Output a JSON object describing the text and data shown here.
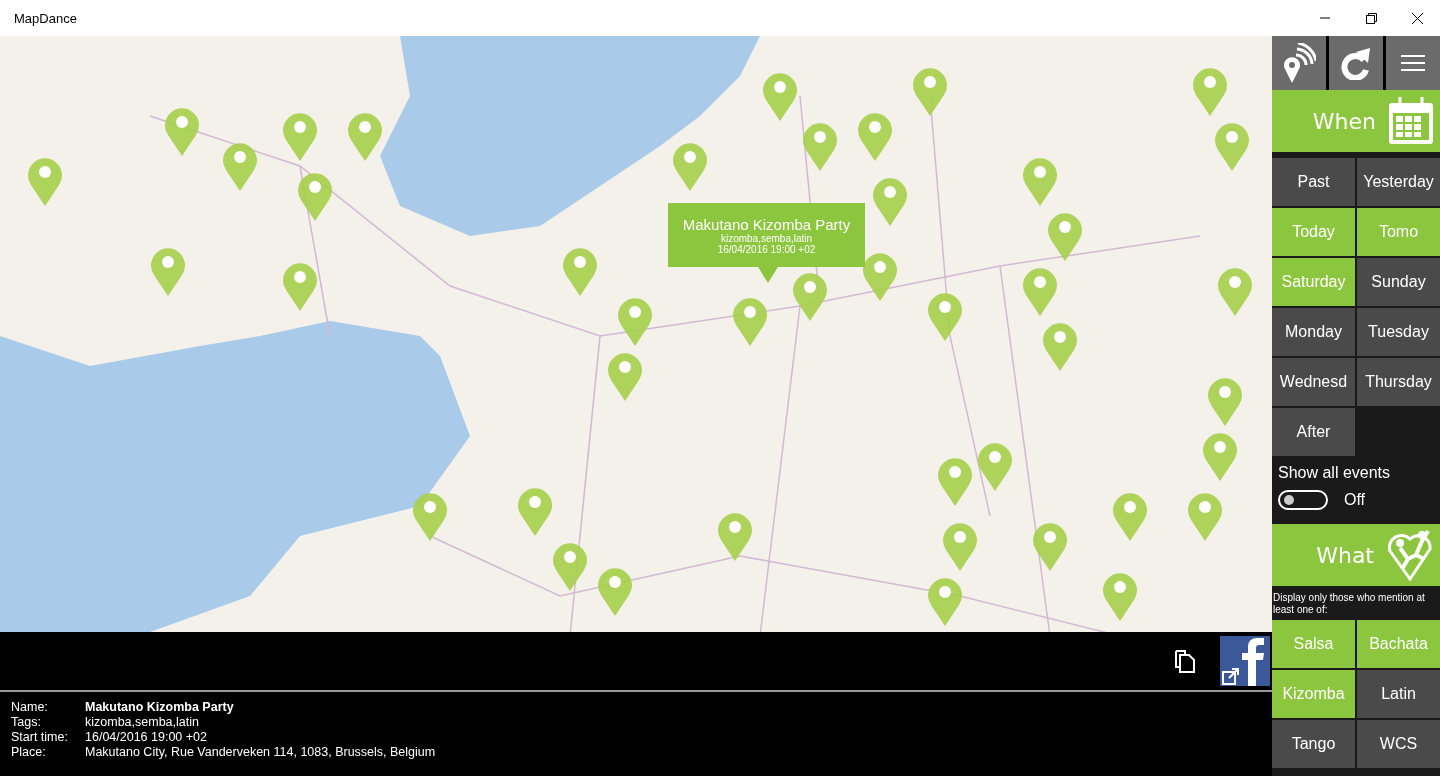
{
  "window": {
    "title": "MapDance"
  },
  "map_popup": {
    "title": "Makutano Kizomba Party",
    "tags": "kizomba,semba,latin",
    "time": "16/04/2016 19:00 +02"
  },
  "details": [
    {
      "label": "Name:",
      "value": "Makutano Kizomba Party"
    },
    {
      "label": "Tags:",
      "value": "kizomba,semba,latin"
    },
    {
      "label": "Start time:",
      "value": "16/04/2016 19:00 +02"
    },
    {
      "label": "Place:",
      "value": "Makutano City, Rue Vanderveken 114, 1083, Brussels, Belgium"
    }
  ],
  "when": {
    "title": "When",
    "days": [
      {
        "label": "Past",
        "selected": false
      },
      {
        "label": "Yesterday",
        "selected": false
      },
      {
        "label": "Today",
        "selected": true
      },
      {
        "label": "Tomo",
        "selected": true
      },
      {
        "label": "Saturday",
        "selected": true
      },
      {
        "label": "Sunday",
        "selected": false
      },
      {
        "label": "Monday",
        "selected": false
      },
      {
        "label": "Tuesday",
        "selected": false
      },
      {
        "label": "Wednesd",
        "selected": false
      },
      {
        "label": "Thursday",
        "selected": false
      },
      {
        "label": "After",
        "selected": false
      }
    ]
  },
  "show_all": {
    "label": "Show all events",
    "on": false,
    "state_text": "Off"
  },
  "what": {
    "title": "What",
    "hint": "Display only those who mention at least one of:",
    "genres": [
      {
        "label": "Salsa",
        "selected": true
      },
      {
        "label": "Bachata",
        "selected": true
      },
      {
        "label": "Kizomba",
        "selected": true
      },
      {
        "label": "Latin",
        "selected": false
      },
      {
        "label": "Tango",
        "selected": false
      },
      {
        "label": "WCS",
        "selected": false
      }
    ]
  }
}
